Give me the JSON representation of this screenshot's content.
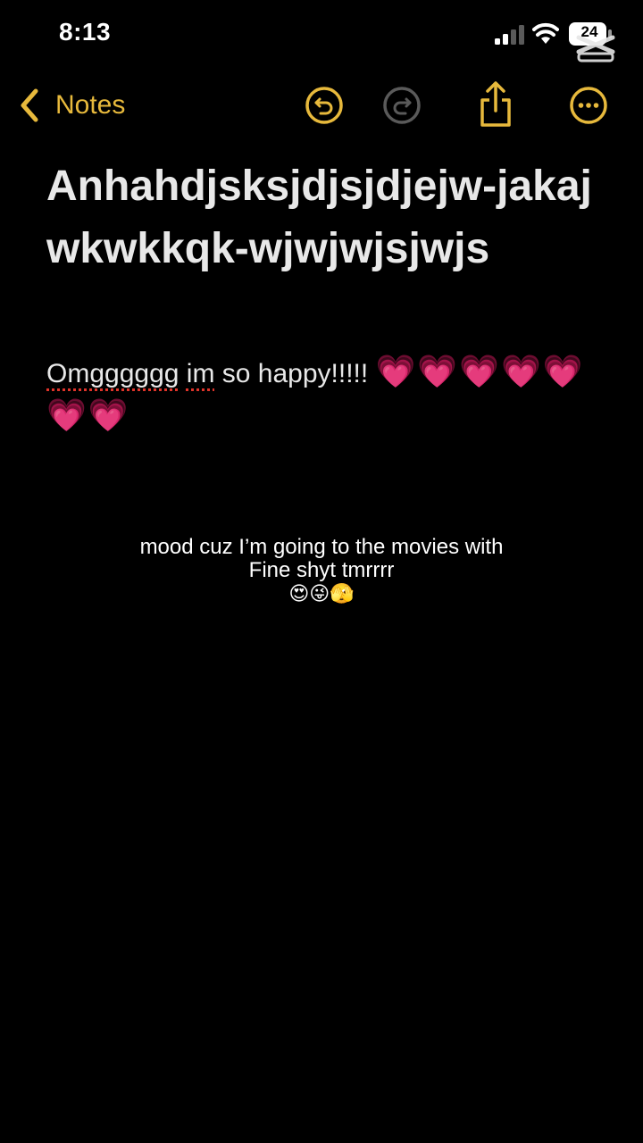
{
  "status_bar": {
    "time": "8:13",
    "battery": "24",
    "icons": [
      "signal-icon",
      "wifi-icon",
      "battery-icon"
    ]
  },
  "watermark": {
    "icon": "capcut-watermark-icon"
  },
  "toolbar": {
    "back_label": "Notes",
    "accent_color": "#e7b93c",
    "icons": [
      "undo-icon",
      "redo-icon",
      "share-icon",
      "more-icon"
    ]
  },
  "note": {
    "title": "Anhahdjsksjdjsjdjejw-jakajwkwkkqk-wjwjwjsjwjs",
    "body": {
      "word1": "Omgggggg",
      "word2": "im",
      "rest": " so happy!!!!!",
      "hearts": "💗💗💗💗💗💗💗"
    }
  },
  "caption": {
    "line1": "mood cuz I’m going to the movies with",
    "line2": "Fine shyt tmrrrr",
    "emoji": "😍😜🫣"
  }
}
